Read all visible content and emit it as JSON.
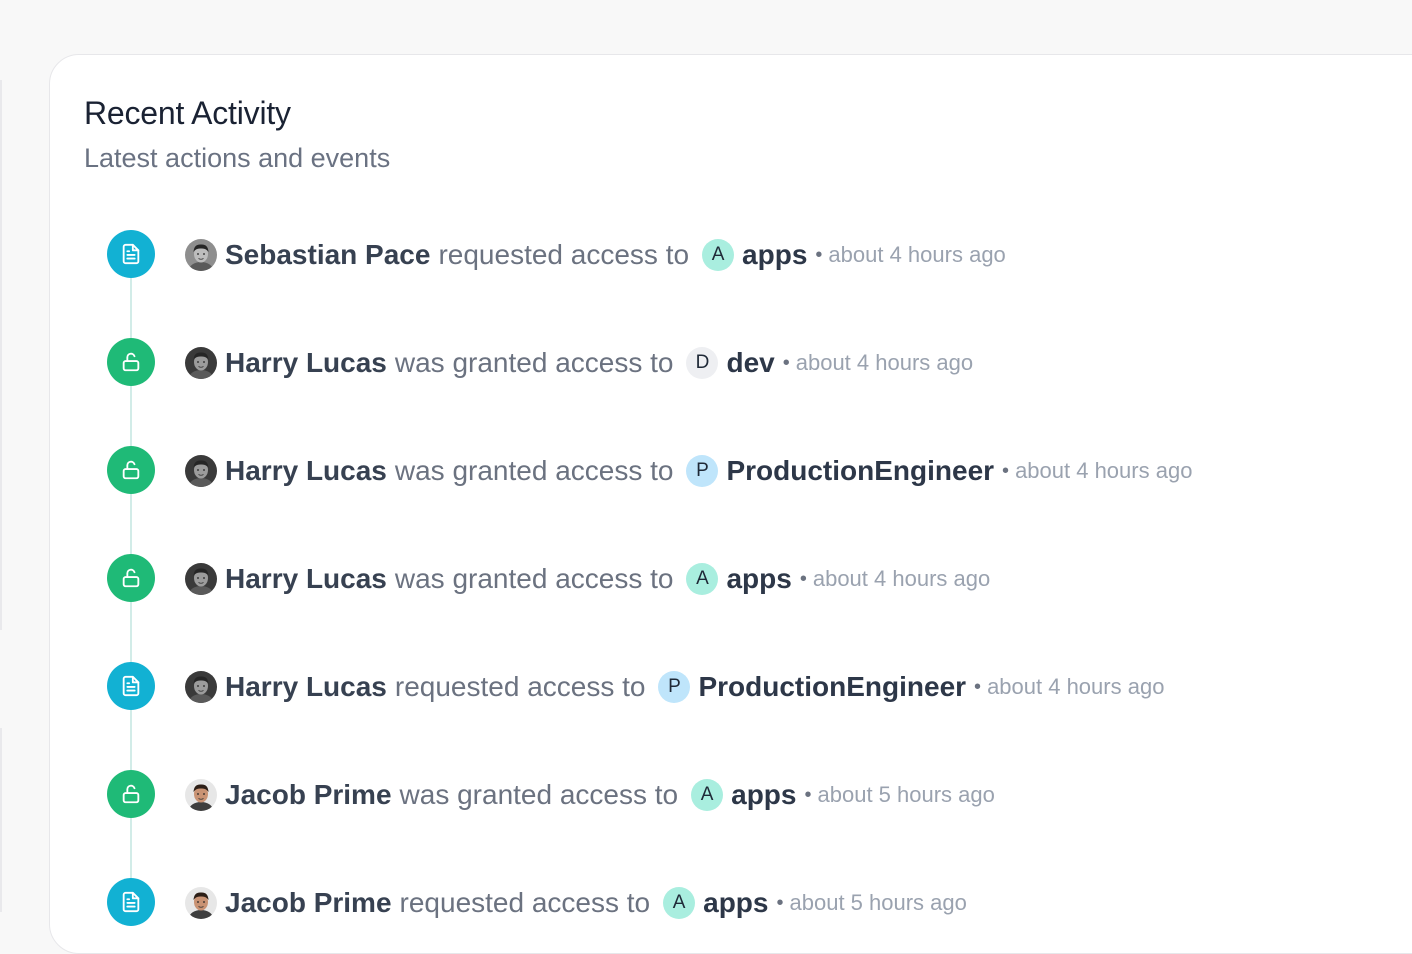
{
  "activity": {
    "title": "Recent Activity",
    "subtitle": "Latest actions and events",
    "colors": {
      "request_icon": "#12b1d3",
      "grant_icon": "#1fba77",
      "timeline_line": "#d2ece8"
    },
    "events": [
      {
        "type": "request",
        "icon": "document-icon",
        "actor": "Sebastian Pace",
        "action": "requested access to",
        "badge_letter": "A",
        "badge_color": "#a9eedf",
        "resource": "apps",
        "separator": "•",
        "time": "about 4 hours ago"
      },
      {
        "type": "grant",
        "icon": "unlock-icon",
        "actor": "Harry Lucas",
        "action": "was granted access to",
        "badge_letter": "D",
        "badge_color": "#eeeff2",
        "resource": "dev",
        "separator": "•",
        "time": "about 4 hours ago"
      },
      {
        "type": "grant",
        "icon": "unlock-icon",
        "actor": "Harry Lucas",
        "action": "was granted access to",
        "badge_letter": "P",
        "badge_color": "#bfe5fb",
        "resource": "ProductionEngineer",
        "separator": "•",
        "time": "about 4 hours ago"
      },
      {
        "type": "grant",
        "icon": "unlock-icon",
        "actor": "Harry Lucas",
        "action": "was granted access to",
        "badge_letter": "A",
        "badge_color": "#a9eedf",
        "resource": "apps",
        "separator": "•",
        "time": "about 4 hours ago"
      },
      {
        "type": "request",
        "icon": "document-icon",
        "actor": "Harry Lucas",
        "action": "requested access to",
        "badge_letter": "P",
        "badge_color": "#bfe5fb",
        "resource": "ProductionEngineer",
        "separator": "•",
        "time": "about 4 hours ago"
      },
      {
        "type": "grant",
        "icon": "unlock-icon",
        "actor": "Jacob Prime",
        "action": "was granted access to",
        "badge_letter": "A",
        "badge_color": "#a9eedf",
        "resource": "apps",
        "separator": "•",
        "time": "about 5 hours ago"
      },
      {
        "type": "request",
        "icon": "document-icon",
        "actor": "Jacob Prime",
        "action": "requested access to",
        "badge_letter": "A",
        "badge_color": "#a9eedf",
        "resource": "apps",
        "separator": "•",
        "time": "about 5 hours ago"
      }
    ]
  }
}
